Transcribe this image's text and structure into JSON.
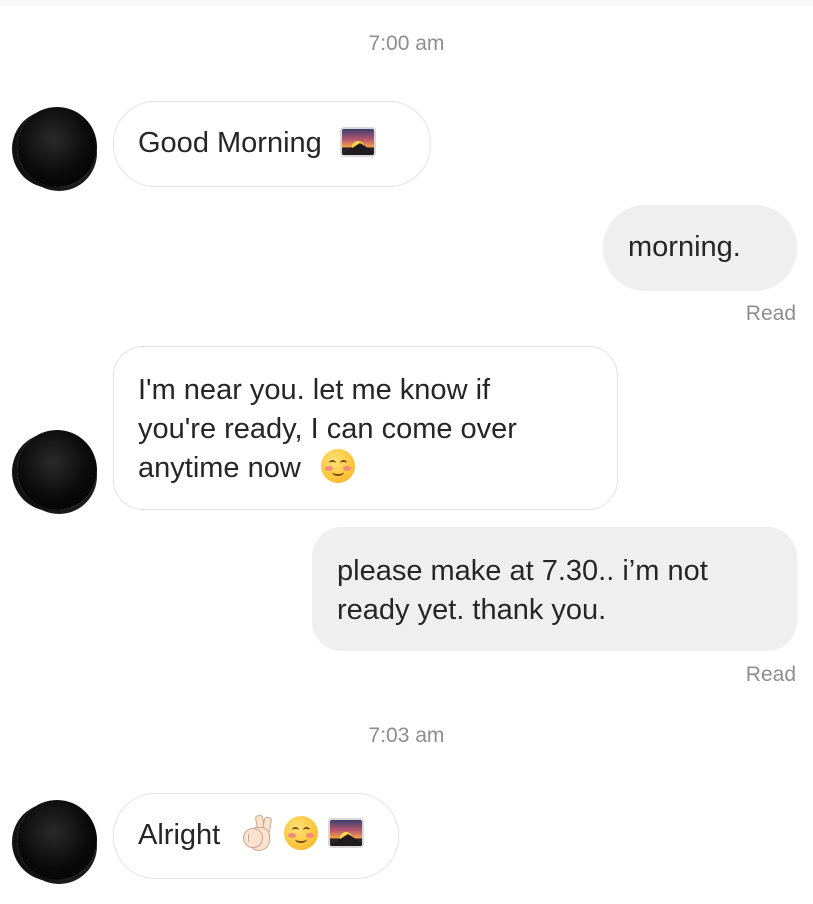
{
  "timestamps": [
    "7:00 am",
    "7:03 am"
  ],
  "messages": [
    {
      "direction": "in",
      "lines": [
        "Good Morning"
      ],
      "emojis": [
        "sunrise-over-mountains-icon"
      ]
    },
    {
      "direction": "out",
      "lines": [
        "morning."
      ],
      "status": "Read"
    },
    {
      "direction": "in",
      "lines": [
        "I'm near you. let me know if",
        "you're ready, I can come over",
        "anytime now"
      ],
      "emojis": [
        "smiling-face-icon"
      ]
    },
    {
      "direction": "out",
      "lines": [
        "please make at 7.30.. i’m not",
        "ready yet. thank you."
      ],
      "status": "Read"
    },
    {
      "direction": "in",
      "lines": [
        "Alright"
      ],
      "emojis": [
        "ok-hand-icon",
        "smiling-face-icon",
        "sunrise-over-mountains-icon"
      ]
    }
  ],
  "colors": {
    "incoming_bubble_bg": "#ffffff",
    "incoming_bubble_border": "#e3e3e3",
    "outgoing_bubble_bg": "#efefef",
    "meta_text": "#8e8e8e",
    "message_text": "#262626"
  }
}
